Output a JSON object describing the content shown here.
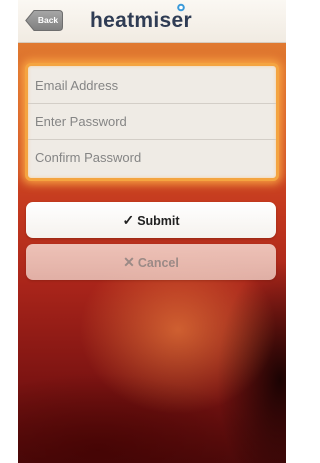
{
  "navbar": {
    "back_label": "Back",
    "logo_text": "heatmiser"
  },
  "form": {
    "email_placeholder": "Email Address",
    "password_placeholder": "Enter Password",
    "confirm_placeholder": "Confirm Password"
  },
  "actions": {
    "submit_icon": "✓",
    "submit_label": "Submit",
    "cancel_icon": "✕",
    "cancel_label": "Cancel"
  },
  "colors": {
    "accent_orange": "#f4a441",
    "logo_navy": "#2f3c54",
    "background_red": "#c53a1f"
  }
}
